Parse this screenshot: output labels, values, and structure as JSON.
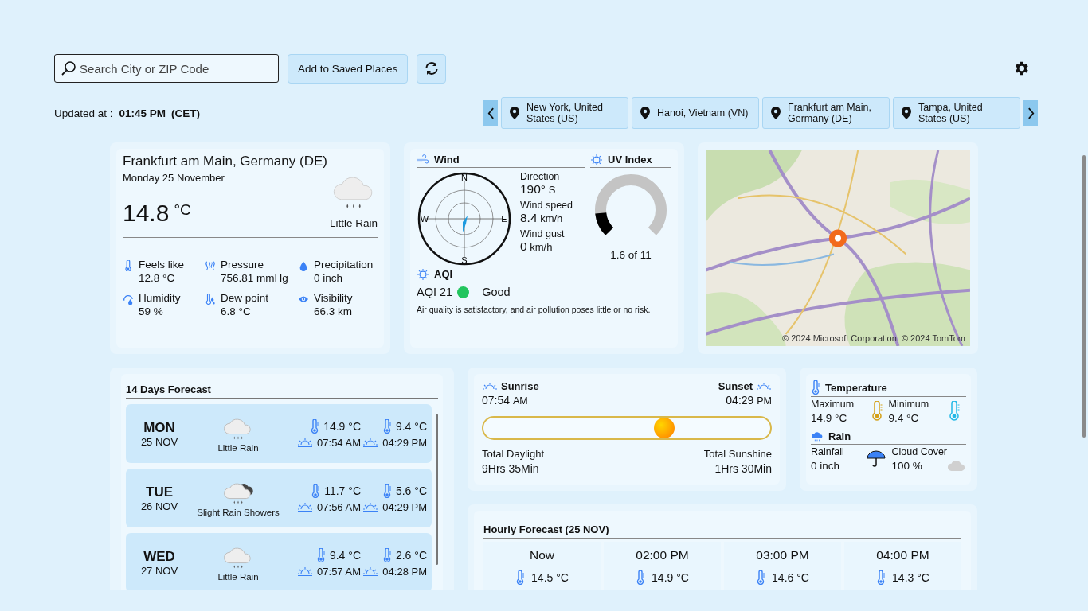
{
  "search": {
    "placeholder": "Search City or ZIP Code"
  },
  "save_button": "Add to Saved Places",
  "updated": {
    "label": "Updated at :",
    "time": "01:45 PM",
    "zone": "(CET)"
  },
  "places": [
    {
      "name": "New York, United States (US)"
    },
    {
      "name": "Hanoi, Vietnam (VN)"
    },
    {
      "name": "Frankfurt am Main, Germany (DE)"
    },
    {
      "name": "Tampa, United States (US)"
    }
  ],
  "current": {
    "city": "Frankfurt am Main, Germany (DE)",
    "date": "Monday 25 November",
    "temp": "14.8",
    "unit": "°C",
    "condition": "Little Rain",
    "details": [
      {
        "kind": "feels",
        "label": "Feels like",
        "value": "12.8 °C"
      },
      {
        "kind": "pressure",
        "label": "Pressure",
        "value": "756.81 mmHg"
      },
      {
        "kind": "precipitation",
        "label": "Precipitation",
        "value": "0 inch"
      },
      {
        "kind": "humidity",
        "label": "Humidity",
        "value": "59 %"
      },
      {
        "kind": "dew",
        "label": "Dew point",
        "value": "6.8 °C"
      },
      {
        "kind": "visibility",
        "label": "Visibility",
        "value": "66.3 km"
      }
    ]
  },
  "wind": {
    "title": "Wind",
    "compass": [
      "N",
      "E",
      "S",
      "W"
    ],
    "stats": [
      {
        "label": "Direction",
        "value": "190°",
        "unit": "S"
      },
      {
        "label": "Wind speed",
        "value": "8.4",
        "unit": "km/h"
      },
      {
        "label": "Wind gust",
        "value": "0",
        "unit": "km/h"
      }
    ]
  },
  "uv": {
    "title": "UV Index",
    "level": 0.145,
    "reading": "1.6 of 11"
  },
  "aqi": {
    "title": "AQI",
    "value": "AQI 21",
    "color": "#22c55e",
    "rating": "Good",
    "description": "Air quality is satisfactory, and air pollution poses little or no risk."
  },
  "map": {
    "kind": "picture",
    "attribution": "© 2024 Microsoft Corporation, © 2024 TomTom"
  },
  "forecast": {
    "title": "14 Days Forecast",
    "days": [
      {
        "day": "MON",
        "date": "25 NOV",
        "kind": "rain",
        "condition": "Little Rain",
        "max": "14.9 °C",
        "min": "9.4 °C",
        "sunrise": "07:54 AM",
        "sunset": "04:29 PM"
      },
      {
        "day": "TUE",
        "date": "26 NOV",
        "kind": "showers",
        "condition": "Slight Rain Showers",
        "max": "11.7 °C",
        "min": "5.6 °C",
        "sunrise": "07:56 AM",
        "sunset": "04:29 PM"
      },
      {
        "day": "WED",
        "date": "27 NOV",
        "kind": "rain",
        "condition": "Little Rain",
        "max": "9.4 °C",
        "min": "2.6 °C",
        "sunrise": "07:57 AM",
        "sunset": "04:28 PM"
      }
    ]
  },
  "sun": {
    "sunrise_label": "Sunrise",
    "sunrise": "07:54",
    "sunrise_ampm": "AM",
    "sunset_label": "Sunset",
    "sunset": "04:29",
    "sunset_ampm": "PM",
    "level": 0.63,
    "daylight_label": "Total Daylight",
    "daylight": "9Hrs 35Min",
    "sunshine_label": "Total Sunshine",
    "sunshine": "1Hrs 30Min"
  },
  "temperature": {
    "title": "Temperature",
    "max_label": "Maximum",
    "max": "14.9 °C",
    "min_label": "Minimum",
    "min": "9.4 °C"
  },
  "rain": {
    "title": "Rain",
    "rainfall_label": "Rainfall",
    "rainfall": "0 inch",
    "cloud_label": "Cloud Cover",
    "cloud": "100 %"
  },
  "hourly": {
    "title": "Hourly Forecast (25 NOV)",
    "hours": [
      {
        "time": "Now",
        "temp": "14.5 °C"
      },
      {
        "time": "02:00 PM",
        "temp": "14.9 °C"
      },
      {
        "time": "03:00 PM",
        "temp": "14.6 °C"
      },
      {
        "time": "04:00 PM",
        "temp": "14.3 °C"
      }
    ]
  }
}
